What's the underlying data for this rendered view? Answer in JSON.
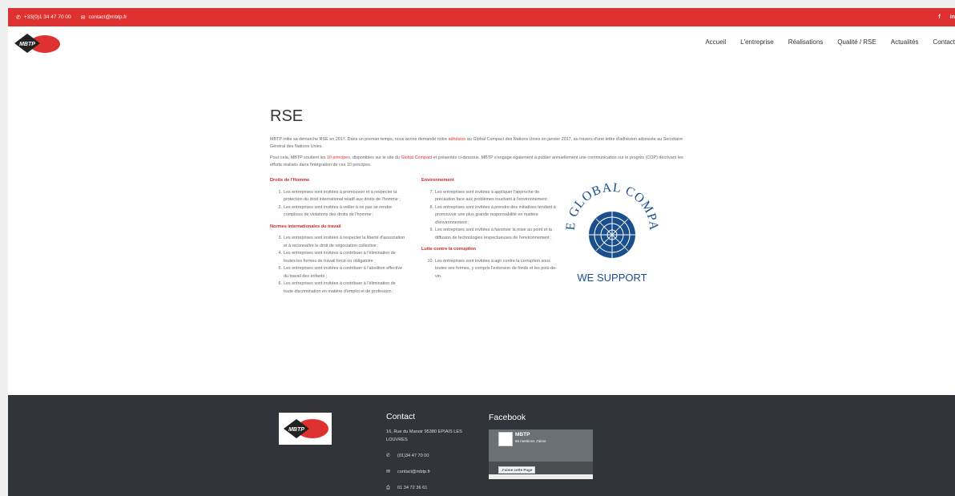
{
  "topbar": {
    "phone": "+33(0)1 34 47 70 00",
    "email": "contact@mbtp.fr",
    "social": [
      "f",
      "in"
    ]
  },
  "nav": {
    "items": [
      "Accueil",
      "L'entreprise",
      "Réalisations",
      "Qualité / RSE",
      "Actualités",
      "Contact"
    ]
  },
  "main": {
    "title": "RSE",
    "intro1_a": "MBTP initie sa démarche RSE en 2017. Dans un premier temps, nous avons demandé notre ",
    "intro1_link": "adhésion",
    "intro1_b": " au Global Compact des Nations Unies en janvier 2017, au travers d'une lettre d'adhésion adressée au Secrétaire Général des Nations Unies.",
    "intro2_a": "Pour cela, MBTP soutient les ",
    "intro2_link1": "10 principes",
    "intro2_b": ", disponibles sur le site du ",
    "intro2_link2": "Global Compact",
    "intro2_c": " et présentés ci-dessous. MBTP s'engage également à publier annuellement une communication sur le progrès (COP) décrivant les efforts réalisés dans l'intégration de ces 10 principes.",
    "sections": [
      {
        "title": "Droits de l'Homme",
        "items": [
          {
            "n": "1.",
            "text": "Les entreprises sont invitées à promouvoir et à respecter la protection du droit international relatif aux droits de l'homme ;"
          },
          {
            "n": "2.",
            "text": "Les entreprises sont invitées à veiller à ne pas se rendre complices de violations des droits de l'homme ;"
          }
        ]
      },
      {
        "title": "Normes internationales du travail",
        "items": [
          {
            "n": "3.",
            "text": "Les entreprises sont invitées à respecter la liberté d'association et à reconnaître le droit de négociation collective ;"
          },
          {
            "n": "4.",
            "text": "Les entreprises sont invitées à contribuer à l'élimination de toutes les formes de travail forcé ou obligatoire ;"
          },
          {
            "n": "5.",
            "text": "Les entreprises sont invitées à contribuer à l'abolition effective du travail des enfants ;"
          },
          {
            "n": "6.",
            "text": "Les entreprises sont invitées à contribuer à l'élimination de toute discrimination en matière d'emploi et de profession ;"
          }
        ]
      },
      {
        "title": "Environnement",
        "items": [
          {
            "n": "7.",
            "text": "Les entreprises sont invitées à appliquer l'approche de précaution face aux problèmes touchant à l'environnement ;"
          },
          {
            "n": "8.",
            "text": "Les entreprises sont invitées à prendre des initiatives tendant à promouvoir une plus grande responsabilité en matière d'environnement ;"
          },
          {
            "n": "9.",
            "text": "Les entreprises sont invitées à favoriser la mise au point et la diffusion de technologies respectueuses de l'environnement ;"
          }
        ]
      },
      {
        "title": "Lutte contre la corruption",
        "items": [
          {
            "n": "10.",
            "text": "Les entreprises sont invitées à agir contre la corruption sous toutes ses formes, y compris l'extorsion de fonds et les pots-de-vin."
          }
        ]
      }
    ],
    "global_compact": {
      "arc_text": "THE GLOBAL COMPACT",
      "support_text": "WE SUPPORT",
      "color": "#1a4f8b"
    }
  },
  "footer": {
    "contact_title": "Contact",
    "address": "16, Rue du Manoir 95380 EPIAIS LES LOUVRES",
    "phone": "(01)34 47 70 00",
    "email": "contact@mbtp.fr",
    "fax": "01 34 72 36 61",
    "facebook_title": "Facebook",
    "fb_name": "MBTP",
    "fb_likes": "66 mentions J'aime",
    "fb_like_button": "J'aime cette Page"
  },
  "colors": {
    "accent": "#e03131",
    "footer_bg": "#313539"
  }
}
